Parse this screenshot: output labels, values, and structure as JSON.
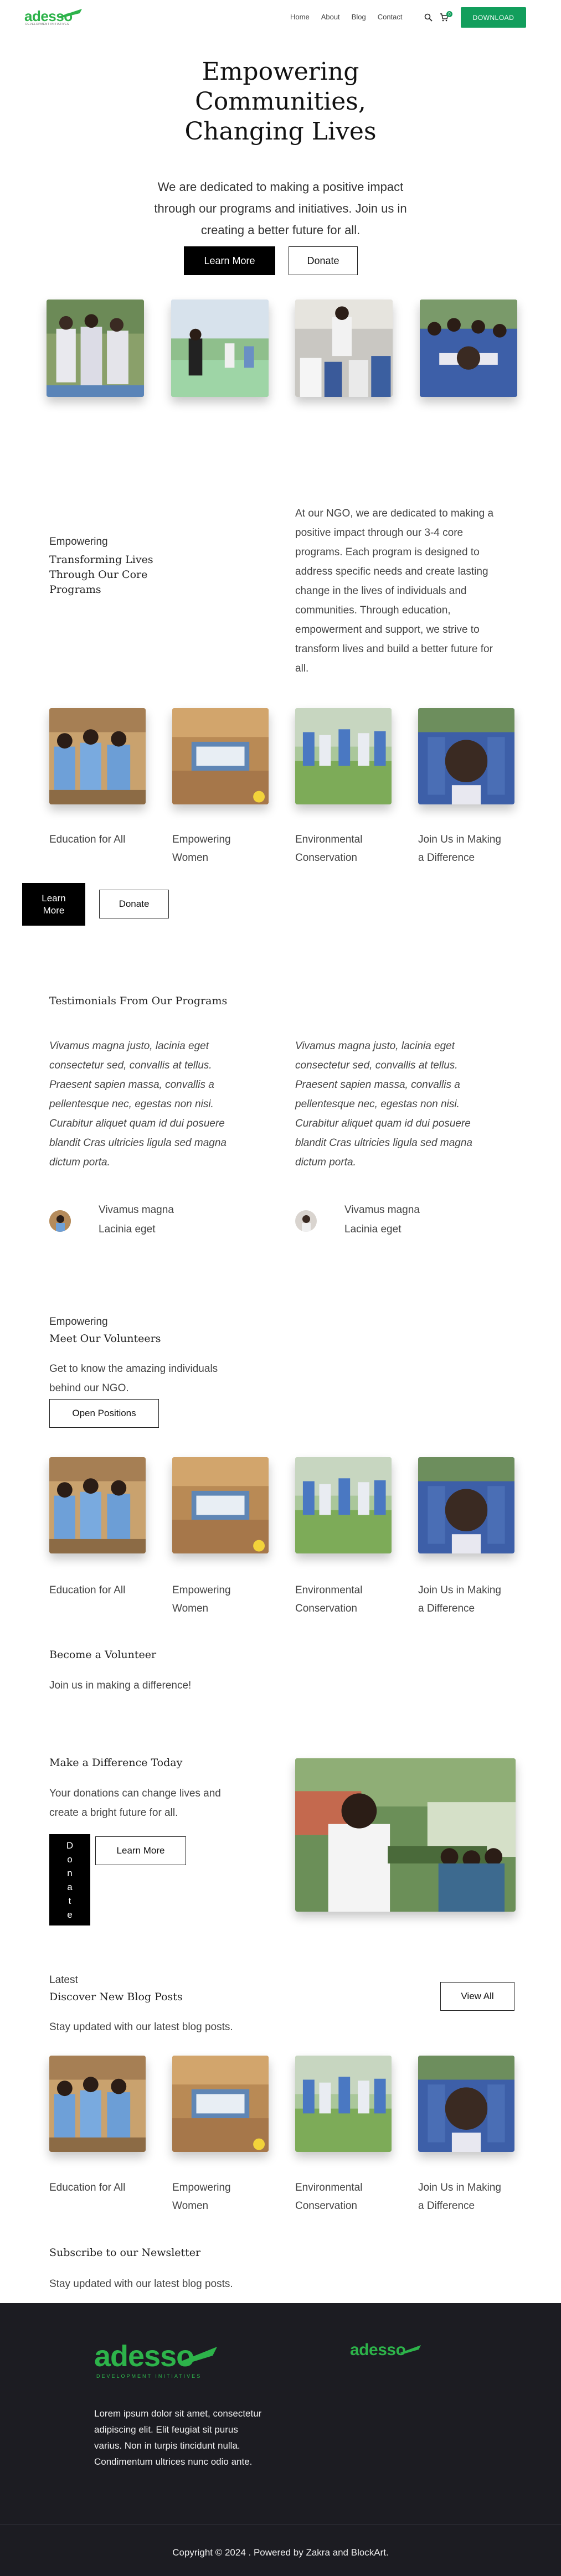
{
  "colors": {
    "accent": "#129e5c",
    "brand_green": "#2db34a",
    "footer_bg": "#1c1c22",
    "dark_button": "#000000"
  },
  "header": {
    "logo_text": "adesso",
    "logo_tagline": "DEVELOPMENT INITIATIVES",
    "nav": [
      "Home",
      "About",
      "Blog",
      "Contact"
    ],
    "search_icon": "search-icon",
    "cart_icon": "cart-icon",
    "cart_count": "0",
    "download_label": "DOWNLOAD"
  },
  "hero": {
    "title_lines": [
      "Empowering",
      "Communities,",
      "Changing Lives"
    ],
    "subtitle_lines": [
      "We are dedicated to making a positive impact",
      "through our programs and initiatives. Join us in",
      "creating a better future for all."
    ],
    "learn_more": "Learn More",
    "donate": "Donate"
  },
  "programs": {
    "kicker": "Empowering",
    "title_lines": [
      "Transforming Lives",
      "Through Our Core",
      "Programs"
    ],
    "description_lines": [
      "At our NGO, we are dedicated to making a",
      "positive impact through our 3-4 core",
      "programs. Each program is designed to",
      "address specific needs and create lasting",
      "change in the lives of individuals and",
      "communities. Through education,",
      "empowerment and support, we strive to",
      "transform lives and build a better future for",
      "all."
    ],
    "cards": [
      {
        "label_lines": [
          "Education for All"
        ]
      },
      {
        "label_lines": [
          "Empowering",
          "Women"
        ]
      },
      {
        "label_lines": [
          "Environmental",
          "Conservation"
        ]
      },
      {
        "label_lines": [
          "Join Us in Making",
          "a Difference"
        ]
      }
    ],
    "learn_more_lines": [
      "Learn",
      "More"
    ],
    "donate": "Donate"
  },
  "testimonials": {
    "title": "Testimonials From Our Programs",
    "items": [
      {
        "quote_lines": [
          "Vivamus magna justo, lacinia eget",
          "consectetur sed, convallis at tellus.",
          "Praesent sapien massa, convallis a",
          "pellentesque nec, egestas non nisi.",
          "Curabitur aliquet quam id dui posuere",
          "blandit Cras ultricies ligula sed magna",
          "dictum porta."
        ],
        "name": "Vivamus magna",
        "role": "Lacinia eget"
      },
      {
        "quote_lines": [
          "Vivamus magna justo, lacinia eget",
          "consectetur sed, convallis at tellus.",
          "Praesent sapien massa, convallis a",
          "pellentesque nec, egestas non nisi.",
          "Curabitur aliquet quam id dui posuere",
          "blandit Cras ultricies ligula sed magna",
          "dictum porta."
        ],
        "name": "Vivamus magna",
        "role": "Lacinia eget"
      }
    ]
  },
  "volunteers": {
    "kicker": "Empowering",
    "title": "Meet Our Volunteers",
    "text_lines": [
      "Get to know the amazing individuals",
      "behind our NGO."
    ],
    "open_positions": "Open Positions",
    "cards": [
      {
        "label_lines": [
          "Education for All"
        ]
      },
      {
        "label_lines": [
          "Empowering",
          "Women"
        ]
      },
      {
        "label_lines": [
          "Environmental",
          "Conservation"
        ]
      },
      {
        "label_lines": [
          "Join Us in Making",
          "a Difference"
        ]
      }
    ],
    "become_title": "Become a Volunteer",
    "become_text": "Join us in making a difference!"
  },
  "difference": {
    "title": "Make a Difference Today",
    "text_lines": [
      "Your donations can change lives and",
      "create a bright future for all."
    ],
    "donate_letters": [
      "D",
      "o",
      "n",
      "a",
      "t",
      "e"
    ],
    "learn_more": "Learn More"
  },
  "blog": {
    "kicker": "Latest",
    "title": "Discover New Blog Posts",
    "text": "Stay updated with our latest blog posts.",
    "view_all": "View All",
    "cards": [
      {
        "label_lines": [
          "Education for All"
        ]
      },
      {
        "label_lines": [
          "Empowering",
          "Women"
        ]
      },
      {
        "label_lines": [
          "Environmental",
          "Conservation"
        ]
      },
      {
        "label_lines": [
          "Join Us in Making",
          "a Difference"
        ]
      }
    ]
  },
  "newsletter": {
    "title": "Subscribe to our Newsletter",
    "text": "Stay updated with our latest blog posts."
  },
  "footer": {
    "logo_text": "adesso",
    "logo_tagline": "DEVELOPMENT INITIATIVES",
    "logo_small": "adesso",
    "about_lines": [
      "Lorem ipsum dolor sit amet, consectetur",
      "adipiscing elit. Elit feugiat sit purus",
      "varius. Non in turpis tincidunt nulla.",
      "Condimentum ultrices nunc odio ante."
    ],
    "copyright": "Copyright © 2024 . Powered by Zakra and BlockArt."
  }
}
